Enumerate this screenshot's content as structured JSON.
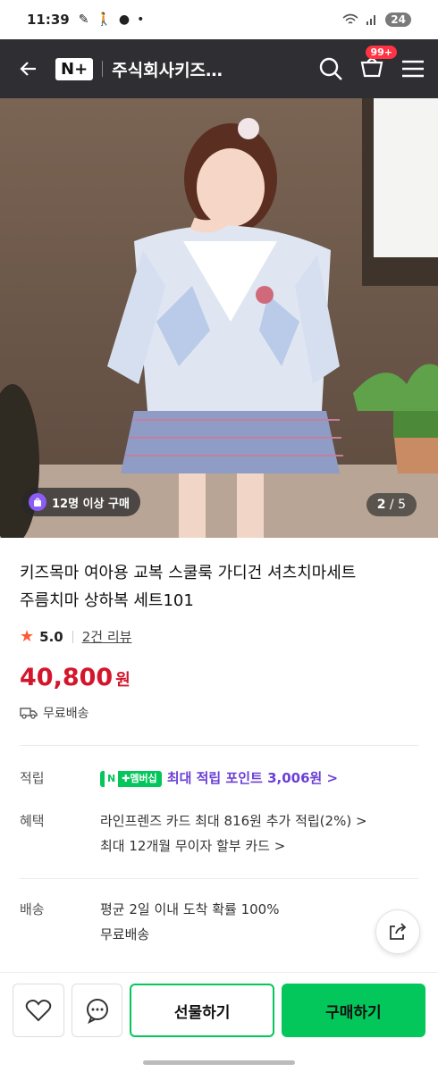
{
  "status": {
    "time": "11:39",
    "battery": "24"
  },
  "appbar": {
    "logo": "N+",
    "store_name": "주식회사키즈…",
    "cart_badge": "99+"
  },
  "hero": {
    "buyers_pill": "12명 이상 구매",
    "current": "2",
    "total": "/ 5"
  },
  "product": {
    "title_line1": "키즈목마 여아용 교복 스쿨룩 가디건 셔츠치마세트",
    "title_line2": "주름치마 상하복 세트101",
    "rating": "5.0",
    "reviews": "2건 리뷰",
    "price": "40,800",
    "currency": "원",
    "shipping": "무료배송"
  },
  "details": {
    "points_label": "적립",
    "membership_badge": "멤버십",
    "points_text": "최대 적립 포인트 3,006원 >",
    "benefit_label": "혜택",
    "benefit_line1": "라인프렌즈 카드 최대 816원 추가 적립(2%) >",
    "benefit_line2": "최대 12개월 무이자 할부 카드 >",
    "delivery_label": "배송",
    "delivery_line1": "평균 2일 이내 도착 확률 100%",
    "delivery_line2": "무료배송"
  },
  "bottom": {
    "gift_label": "선물하기",
    "buy_label": "구매하기"
  },
  "colors": {
    "brand_green": "#03c75a",
    "price_red": "#d3162b",
    "appbar": "#2e2e33",
    "point_purple": "#6b3fd6"
  }
}
